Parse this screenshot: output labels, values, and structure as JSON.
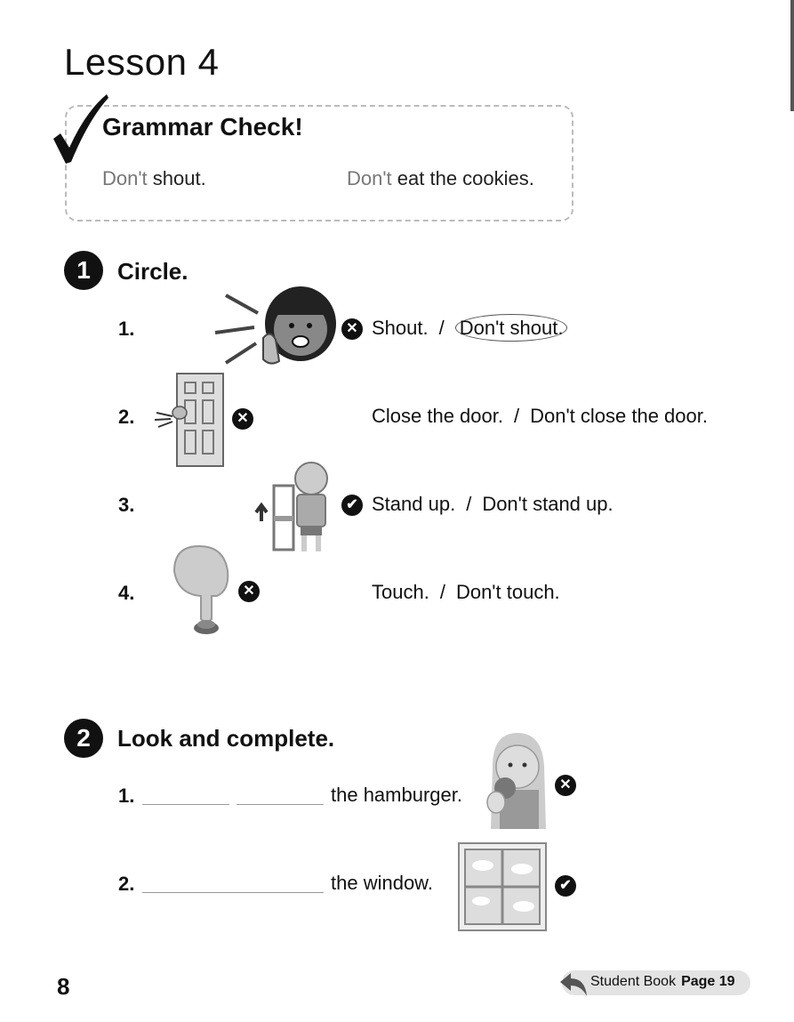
{
  "lesson": {
    "title": "Lesson 4"
  },
  "grammar_check": {
    "title": "Grammar Check!",
    "examples": [
      {
        "dont": "Don't",
        "rest": " shout."
      },
      {
        "dont": "Don't",
        "rest": " eat the cookies."
      }
    ]
  },
  "section1": {
    "number": "1",
    "title": "Circle.",
    "items": [
      {
        "num": "1.",
        "mark": "✕",
        "a": "Shout.",
        "sep": "/",
        "b": "Don't shout."
      },
      {
        "num": "2.",
        "mark": "✕",
        "a": "Close the door.",
        "sep": "/",
        "b": "Don't close the door."
      },
      {
        "num": "3.",
        "mark": "✔",
        "a": "Stand up.",
        "sep": "/",
        "b": "Don't stand up."
      },
      {
        "num": "4.",
        "mark": "✕",
        "a": "Touch.",
        "sep": "/",
        "b": "Don't touch."
      }
    ]
  },
  "section2": {
    "number": "2",
    "title": "Look and complete.",
    "items": [
      {
        "num": "1.",
        "text": "the hamburger.",
        "mark": "✕"
      },
      {
        "num": "2.",
        "text": "the window.",
        "mark": "✔"
      }
    ]
  },
  "footer": {
    "page_number": "8",
    "ref_label": "Student Book",
    "ref_page": "Page 19"
  }
}
